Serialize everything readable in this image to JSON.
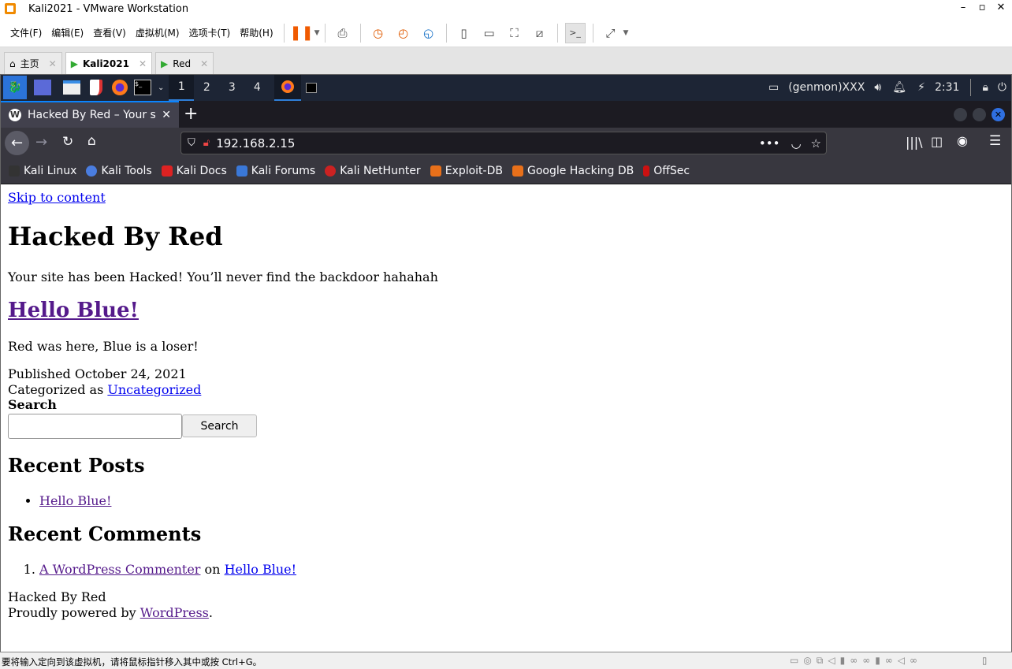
{
  "window": {
    "title": "Kali2021 - VMware Workstation"
  },
  "menu": [
    "文件(F)",
    "编辑(E)",
    "查看(V)",
    "虚拟机(M)",
    "选项卡(T)",
    "帮助(H)"
  ],
  "vm_tabs": [
    {
      "label": "主页"
    },
    {
      "label": "Kali2021"
    },
    {
      "label": "Red"
    }
  ],
  "kali_panel": {
    "workspaces": [
      "1",
      "2",
      "3",
      "4"
    ],
    "genmon": "(genmon)XXX",
    "clock": "2:31"
  },
  "browser": {
    "tab_title": "Hacked By Red – Your site",
    "url": "192.168.2.15",
    "bookmarks": [
      "Kali Linux",
      "Kali Tools",
      "Kali Docs",
      "Kali Forums",
      "Kali NetHunter",
      "Exploit-DB",
      "Google Hacking DB",
      "OffSec"
    ]
  },
  "page": {
    "skip": "Skip to content",
    "site_title": "Hacked By Red",
    "tagline": "Your site has been Hacked! You’ll never find the backdoor hahahah",
    "post_title": "Hello Blue!",
    "post_body": "Red was here, Blue is a loser!",
    "published_prefix": "Published",
    "published_date": "October 24, 2021",
    "categorized_prefix": "Categorized as",
    "category": "Uncategorized",
    "search_label": "Search",
    "search_placeholder": "",
    "search_button": "Search",
    "recent_posts_heading": "Recent Posts",
    "recent_posts": [
      "Hello Blue!"
    ],
    "recent_comments_heading": "Recent Comments",
    "comment_author": "A WordPress Commenter",
    "comment_on": "on",
    "comment_post": "Hello Blue!",
    "footer_site": "Hacked By Red",
    "footer_powered": "Proudly powered by",
    "footer_link": "WordPress"
  },
  "statusbar": {
    "message": "要将输入定向到该虚拟机，请将鼠标指针移入其中或按 Ctrl+G。"
  }
}
